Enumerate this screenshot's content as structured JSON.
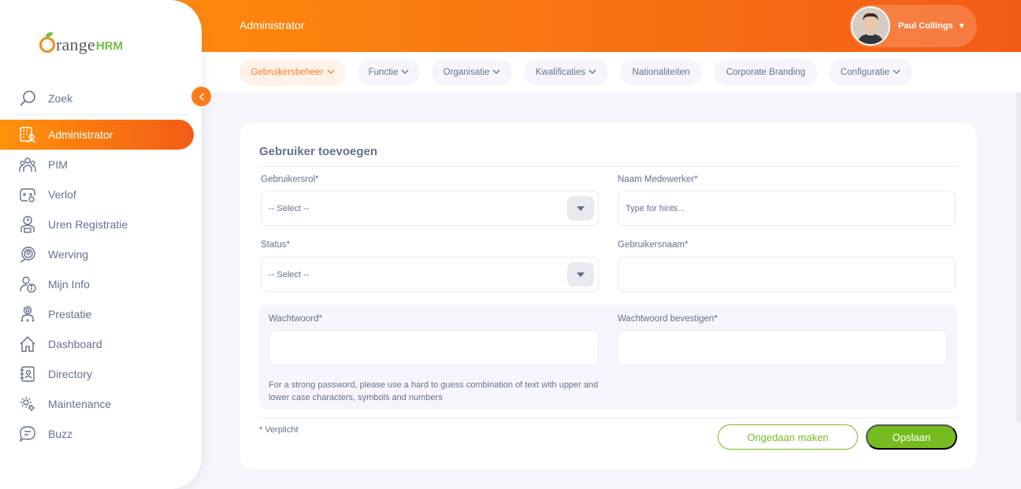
{
  "logo": {
    "text_main": "range",
    "text_suffix": "HRM"
  },
  "sidebar": {
    "search_label": "Zoek",
    "items": [
      {
        "label": "Administrator",
        "icon": "admin-icon",
        "active": true
      },
      {
        "label": "PIM",
        "icon": "pim-icon"
      },
      {
        "label": "Verlof",
        "icon": "leave-icon"
      },
      {
        "label": "Uren Registratie",
        "icon": "time-icon"
      },
      {
        "label": "Werving",
        "icon": "recruitment-icon"
      },
      {
        "label": "Mijn Info",
        "icon": "my-info-icon"
      },
      {
        "label": "Prestatie",
        "icon": "performance-icon"
      },
      {
        "label": "Dashboard",
        "icon": "dashboard-icon"
      },
      {
        "label": "Directory",
        "icon": "directory-icon"
      },
      {
        "label": "Maintenance",
        "icon": "maintenance-icon"
      },
      {
        "label": "Buzz",
        "icon": "buzz-icon"
      }
    ]
  },
  "header": {
    "title": "Administrator",
    "user_name": "Paul Collings"
  },
  "tabs": [
    {
      "label": "Gebruikersbeheer",
      "active": true,
      "dropdown": true
    },
    {
      "label": "Functie",
      "dropdown": true
    },
    {
      "label": "Organisatie",
      "dropdown": true
    },
    {
      "label": "Kwalificaties",
      "dropdown": true
    },
    {
      "label": "Nationaliteiten",
      "dropdown": false
    },
    {
      "label": "Corporate Branding",
      "dropdown": false
    },
    {
      "label": "Configuratie",
      "dropdown": true
    }
  ],
  "form": {
    "title": "Gebruiker toevoegen",
    "user_role_label": "Gebruikersrol*",
    "user_role_value": "-- Select --",
    "employee_name_label": "Naam Medewerker*",
    "employee_name_placeholder": "Type for hints...",
    "status_label": "Status*",
    "status_value": "-- Select --",
    "username_label": "Gebruikersnaam*",
    "password_label": "Wachtwoord*",
    "confirm_password_label": "Wachtwoord bevestigen*",
    "password_hint": "For a strong password, please use a hard to guess combination of text with upper and lower case characters, symbols and numbers",
    "required_note": "* Verplicht",
    "cancel_label": "Ongedaan maken",
    "save_label": "Opslaan"
  },
  "colors": {
    "accent": "#ff7b1d",
    "brand_gradient_start": "#ff920b",
    "brand_gradient_end": "#f35c17",
    "success": "#76bc21",
    "text": "#64728c",
    "background": "#f6f5fb"
  }
}
